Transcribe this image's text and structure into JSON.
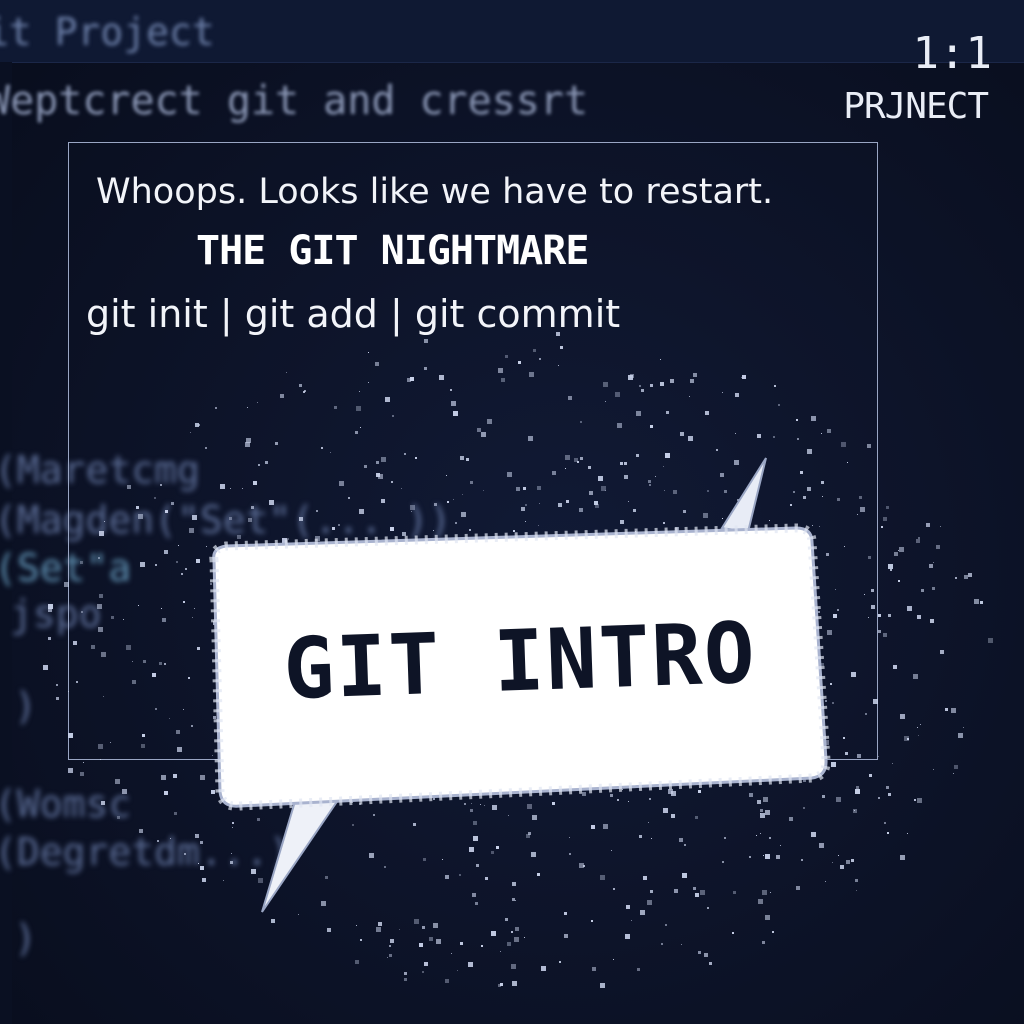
{
  "background_code": {
    "window_title": "it Project",
    "top_line": "Weptcrect git and cressrt",
    "lines": [
      "(Maretcmg",
      "(Magden(\"Set\"(... ))",
      "(Set\"a",
      " jspo",
      ")",
      "(Womsc",
      "(Degretdm...)",
      ")"
    ]
  },
  "corner": {
    "ratio": "1:1",
    "project": "PRJNECT"
  },
  "card": {
    "headline": "Whoops. Looks like we have to restart.",
    "title": "THE GIT NIGHTMARE",
    "commands": "git init | git add | git commit"
  },
  "bubble": {
    "label": "GIT INTRO"
  },
  "colors": {
    "background": "#0d1428",
    "text": "#f2f4f9",
    "bubble": "#ffffff",
    "bubble_text": "#0e1426",
    "particles": "#c9d2ea"
  }
}
